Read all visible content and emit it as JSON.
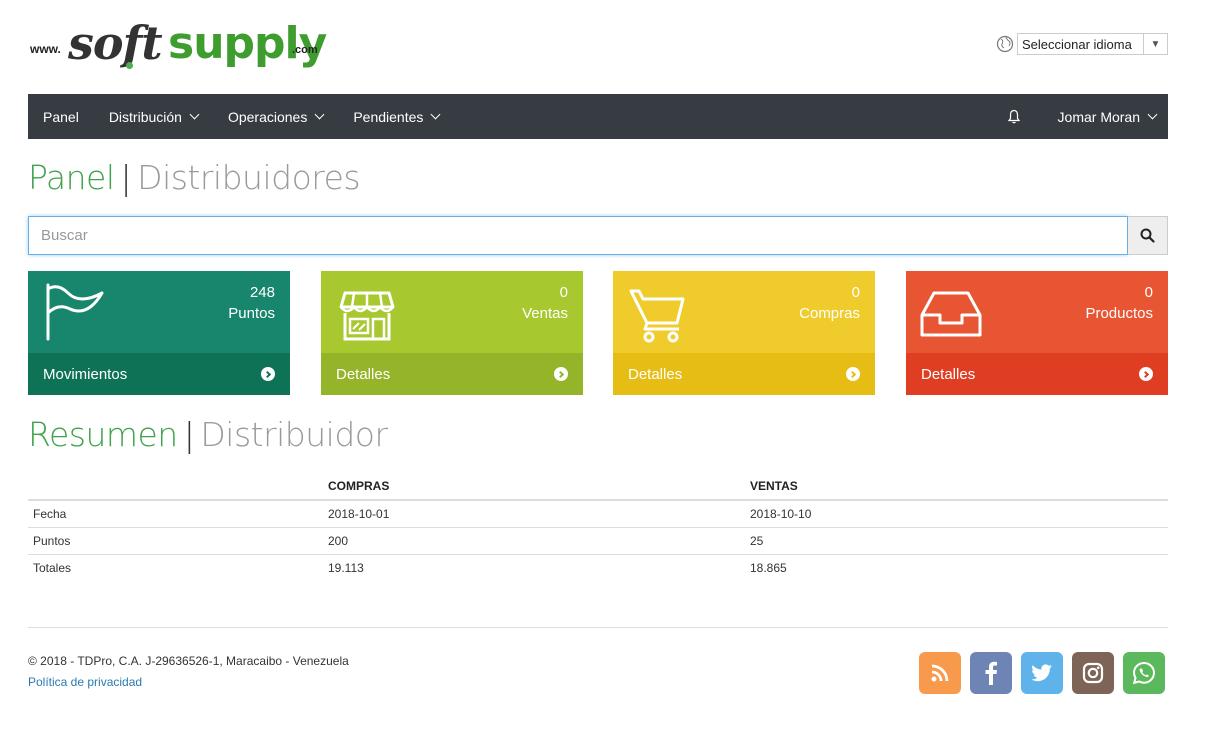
{
  "logo": {
    "www": "www.",
    "soft": "soft",
    "supply": "supply",
    "com": ".com"
  },
  "language": {
    "label": "Seleccionar idioma",
    "arrow": "▼"
  },
  "nav": {
    "items": [
      {
        "label": "Panel"
      },
      {
        "label": "Distribución"
      },
      {
        "label": "Operaciones"
      },
      {
        "label": "Pendientes"
      }
    ],
    "user": "Jomar Moran"
  },
  "page_heading": {
    "primary": "Panel",
    "separator": "|",
    "secondary": "Distribuidores"
  },
  "search": {
    "placeholder": "Buscar"
  },
  "cards": [
    {
      "count": "248",
      "label": "Puntos",
      "footer": "Movimientos",
      "top_color": "#17866c",
      "bottom_color": "#0e7256",
      "icon": "flag-icon"
    },
    {
      "count": "0",
      "label": "Ventas",
      "footer": "Detalles",
      "top_color": "#a7c82e",
      "bottom_color": "#94b42a",
      "icon": "store-icon"
    },
    {
      "count": "0",
      "label": "Compras",
      "footer": "Detalles",
      "top_color": "#efcc2c",
      "bottom_color": "#e6bd14",
      "icon": "cart-icon"
    },
    {
      "count": "0",
      "label": "Productos",
      "footer": "Detalles",
      "top_color": "#e75533",
      "bottom_color": "#df3e22",
      "icon": "inbox-icon"
    }
  ],
  "summary_heading": {
    "primary": "Resumen",
    "separator": "|",
    "secondary": "Distribuidor"
  },
  "table": {
    "headers": [
      "",
      "COMPRAS",
      "VENTAS"
    ],
    "rows": [
      [
        "Fecha",
        "2018-10-01",
        "2018-10-10"
      ],
      [
        "Puntos",
        "200",
        "25"
      ],
      [
        "Totales",
        "19.113",
        "18.865"
      ]
    ]
  },
  "footer": {
    "copyright": "© 2018 - TDPro, C.A. J-29636526-1, Maracaibo - Venezuela",
    "privacy": "Política de privacidad"
  },
  "social": [
    {
      "icon": "rss-icon",
      "color": "#f79a4b"
    },
    {
      "icon": "facebook-icon",
      "color": "#6d84b4"
    },
    {
      "icon": "twitter-icon",
      "color": "#5eb3ea"
    },
    {
      "icon": "instagram-icon",
      "color": "#7d6457"
    },
    {
      "icon": "whatsapp-icon",
      "color": "#5cb85c"
    }
  ]
}
